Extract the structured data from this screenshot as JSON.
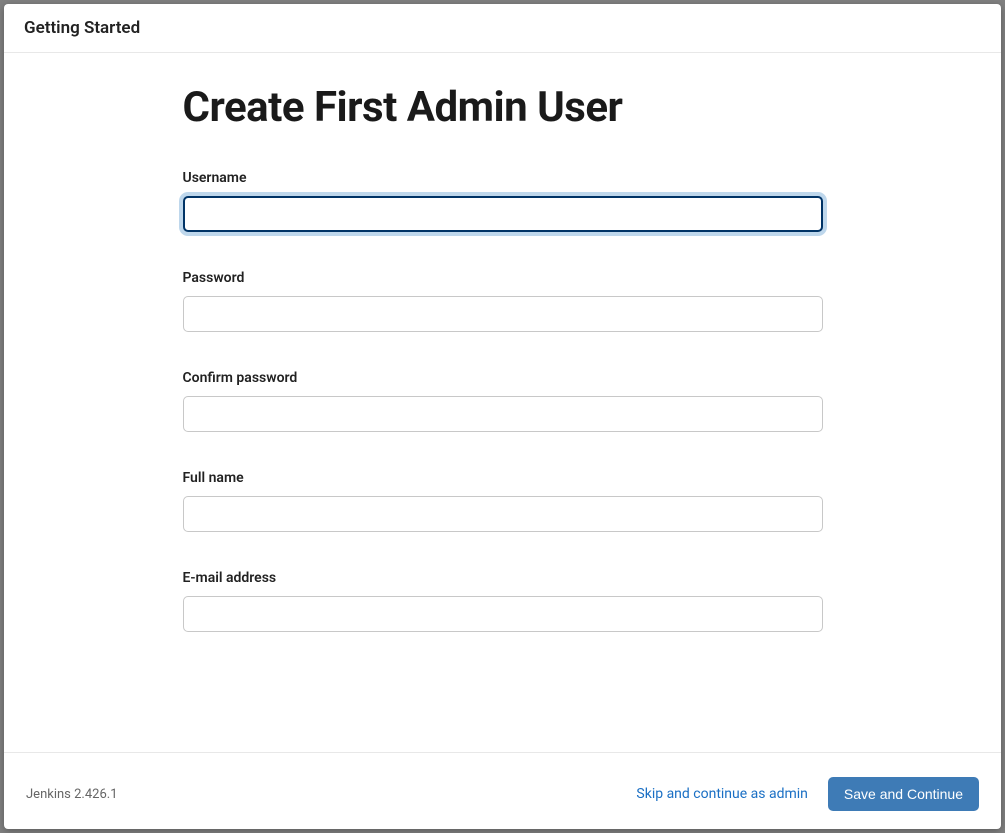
{
  "header": {
    "title": "Getting Started"
  },
  "main": {
    "page_title": "Create First Admin User",
    "fields": {
      "username": {
        "label": "Username",
        "value": ""
      },
      "password": {
        "label": "Password",
        "value": ""
      },
      "confirm_password": {
        "label": "Confirm password",
        "value": ""
      },
      "full_name": {
        "label": "Full name",
        "value": ""
      },
      "email": {
        "label": "E-mail address",
        "value": ""
      }
    }
  },
  "footer": {
    "version_text": "Jenkins 2.426.1",
    "skip_label": "Skip and continue as admin",
    "save_label": "Save and Continue"
  }
}
